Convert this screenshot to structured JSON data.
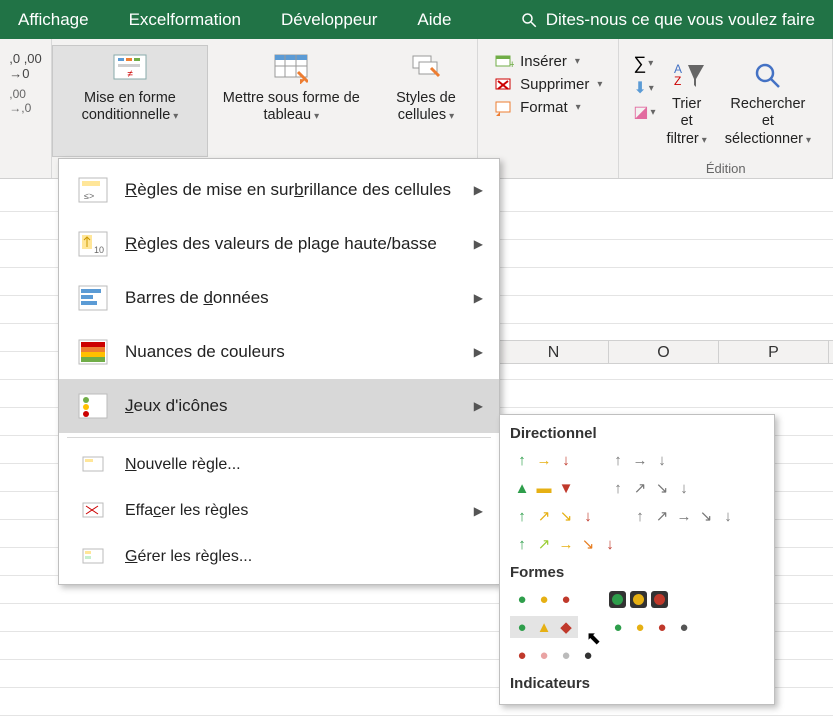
{
  "tabs": {
    "affichage": "Affichage",
    "excelformation": "Excelformation",
    "developpeur": "Développeur",
    "aide": "Aide",
    "search_hint": "Dites-nous ce que vous voulez faire"
  },
  "ribbon": {
    "number_decimals_inc": ",0",
    "number_decimals_dec": ",00",
    "cond_format": "Mise en forme conditionnelle",
    "table_format": "Mettre sous forme de tableau",
    "cell_styles": "Styles de cellules",
    "insert": "Insérer",
    "delete": "Supprimer",
    "format": "Format",
    "sort_filter": "Trier et filtrer",
    "find_select": "Rechercher et sélectionner",
    "edit_group": "Édition"
  },
  "menu": {
    "highlight_rules": "Règles de mise en surbrillance des cellules",
    "top_bottom": "Règles des valeurs de plage haute/basse",
    "data_bars": "Barres de données",
    "color_scales": "Nuances de couleurs",
    "icon_sets": "Jeux d'icônes",
    "new_rule": "Nouvelle règle...",
    "clear_rules": "Effacer les règles",
    "manage_rules": "Gérer les règles..."
  },
  "submenu": {
    "directional": "Directionnel",
    "shapes": "Formes",
    "indicators": "Indicateurs"
  },
  "columns": {
    "n": "N",
    "o": "O",
    "p": "P"
  }
}
